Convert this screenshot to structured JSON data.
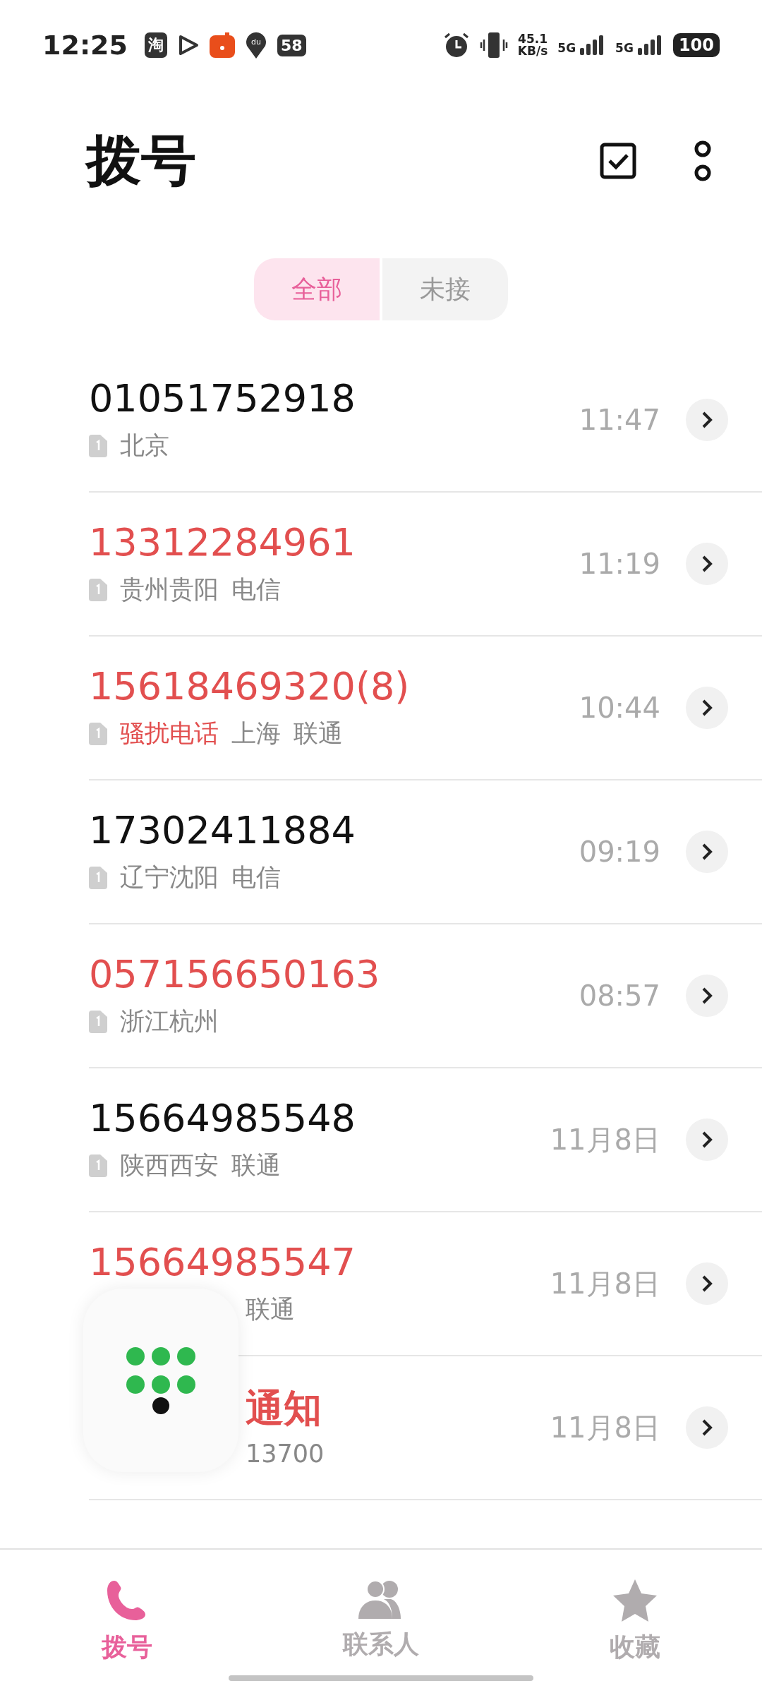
{
  "status_bar": {
    "time": "12:25",
    "app_badges": [
      "淘"
    ],
    "map_label": "du",
    "count_badge": "58",
    "speed": "45.1",
    "speed_unit": "KB/s",
    "networks": [
      "5G",
      "5G"
    ],
    "battery": "100"
  },
  "header": {
    "title": "拨号"
  },
  "tabs": [
    {
      "label": "全部",
      "selected": true
    },
    {
      "label": "未接",
      "selected": false
    }
  ],
  "calls": [
    {
      "name": "01051752918",
      "missed": false,
      "sim_card": true,
      "name_covered": false,
      "sub_covered": false,
      "details": [
        {
          "text": "北京",
          "kind": "plain"
        }
      ],
      "time": "11:47"
    },
    {
      "name": "13312284961",
      "missed": true,
      "sim_card": true,
      "name_covered": false,
      "sub_covered": false,
      "details": [
        {
          "text": "贵州贵阳",
          "kind": "plain"
        },
        {
          "text": "电信",
          "kind": "plain"
        }
      ],
      "time": "11:19"
    },
    {
      "name": "15618469320(8)",
      "missed": true,
      "sim_card": true,
      "name_covered": false,
      "sub_covered": false,
      "details": [
        {
          "text": "骚扰电话",
          "kind": "tag"
        },
        {
          "text": "上海",
          "kind": "plain"
        },
        {
          "text": "联通",
          "kind": "plain"
        }
      ],
      "time": "10:44"
    },
    {
      "name": "17302411884",
      "missed": false,
      "sim_card": true,
      "name_covered": false,
      "sub_covered": false,
      "details": [
        {
          "text": "辽宁沈阳",
          "kind": "plain"
        },
        {
          "text": "电信",
          "kind": "plain"
        }
      ],
      "time": "09:19"
    },
    {
      "name": "057156650163",
      "missed": true,
      "sim_card": true,
      "name_covered": false,
      "sub_covered": false,
      "details": [
        {
          "text": "浙江杭州",
          "kind": "plain"
        }
      ],
      "time": "08:57"
    },
    {
      "name": "15664985548",
      "missed": false,
      "sim_card": true,
      "name_covered": false,
      "sub_covered": false,
      "details": [
        {
          "text": "陕西西安",
          "kind": "plain"
        },
        {
          "text": "联通",
          "kind": "plain"
        }
      ],
      "time": "11月8日"
    },
    {
      "name": "15664985547",
      "missed": true,
      "sim_card": false,
      "name_covered": false,
      "sub_covered": true,
      "details": [
        {
          "text": "联通",
          "kind": "plain"
        }
      ],
      "time": "11月8日"
    },
    {
      "name": "通知",
      "missed": true,
      "sim_card": false,
      "name_covered": true,
      "sub_covered": true,
      "details": [
        {
          "text": "13700",
          "kind": "plain"
        }
      ],
      "time": "11月8日"
    }
  ],
  "bottom_nav": [
    {
      "label": "拨号",
      "selected": true
    },
    {
      "label": "联系人",
      "selected": false
    },
    {
      "label": "收藏",
      "selected": false
    }
  ]
}
